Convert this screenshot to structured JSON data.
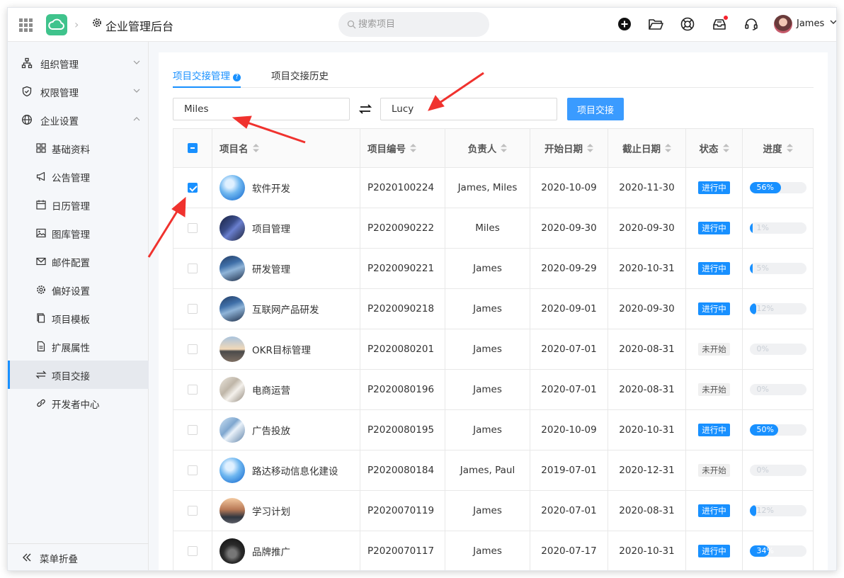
{
  "topbar": {
    "brand_title": "企业管理后台",
    "search_placeholder": "搜索项目",
    "user_name": "James"
  },
  "sidebar": {
    "items": [
      {
        "label": "组织管理",
        "icon": "org-chart-icon",
        "expandable": true
      },
      {
        "label": "权限管理",
        "icon": "shield-icon",
        "expandable": true
      },
      {
        "label": "企业设置",
        "icon": "globe-icon",
        "expandable": true,
        "expanded": true
      },
      {
        "label": "基础资料",
        "icon": "grid-icon"
      },
      {
        "label": "公告管理",
        "icon": "megaphone-icon"
      },
      {
        "label": "日历管理",
        "icon": "calendar-icon"
      },
      {
        "label": "图库管理",
        "icon": "image-icon"
      },
      {
        "label": "邮件配置",
        "icon": "mail-icon"
      },
      {
        "label": "偏好设置",
        "icon": "gear-icon"
      },
      {
        "label": "项目模板",
        "icon": "copy-icon"
      },
      {
        "label": "扩展属性",
        "icon": "document-icon"
      },
      {
        "label": "项目交接",
        "icon": "swap-icon",
        "active": true
      },
      {
        "label": "开发者中心",
        "icon": "link-icon"
      }
    ],
    "collapse_label": "菜单折叠"
  },
  "tabs": [
    {
      "label": "项目交接管理",
      "active": true
    },
    {
      "label": "项目交接历史"
    }
  ],
  "transfer": {
    "from_value": "Miles",
    "to_value": "Lucy",
    "button_label": "项目交接"
  },
  "table": {
    "headers": [
      "项目名",
      "项目编号",
      "负责人",
      "开始日期",
      "截止日期",
      "状态",
      "进度"
    ],
    "rows": [
      {
        "checked": true,
        "name": "软件开发",
        "code": "P2020100224",
        "owner": "James, Miles",
        "start": "2020-10-09",
        "end": "2020-11-30",
        "status": "进行中",
        "progress": 56,
        "progress_label": "56%",
        "thumb": "sky"
      },
      {
        "checked": false,
        "name": "项目管理",
        "code": "P2020090222",
        "owner": "Miles",
        "start": "2020-09-30",
        "end": "2020-09-30",
        "status": "进行中",
        "progress": 1,
        "progress_label": "1%",
        "thumb": "code"
      },
      {
        "checked": false,
        "name": "研发管理",
        "code": "P2020090221",
        "owner": "James",
        "start": "2020-09-29",
        "end": "2020-10-31",
        "status": "进行中",
        "progress": 5,
        "progress_label": "5%",
        "thumb": "code2"
      },
      {
        "checked": false,
        "name": "互联网产品研发",
        "code": "P2020090218",
        "owner": "James",
        "start": "2020-09-01",
        "end": "2020-09-30",
        "status": "进行中",
        "progress": 12,
        "progress_label": "12%",
        "thumb": "code2"
      },
      {
        "checked": false,
        "name": "OKR目标管理",
        "code": "P2020080201",
        "owner": "James",
        "start": "2020-07-01",
        "end": "2020-08-31",
        "status": "未开始",
        "progress": 0,
        "progress_label": "0%",
        "thumb": "dusk"
      },
      {
        "checked": false,
        "name": "电商运营",
        "code": "P2020080196",
        "owner": "James",
        "start": "2020-07-01",
        "end": "2020-08-31",
        "status": "未开始",
        "progress": 0,
        "progress_label": "0%",
        "thumb": "office"
      },
      {
        "checked": false,
        "name": "广告投放",
        "code": "P2020080195",
        "owner": "James",
        "start": "2020-10-09",
        "end": "2020-10-31",
        "status": "进行中",
        "progress": 50,
        "progress_label": "50%",
        "thumb": "building"
      },
      {
        "checked": false,
        "name": "路达移动信息化建设",
        "code": "P2020080184",
        "owner": "James, Paul",
        "start": "2019-07-01",
        "end": "2020-12-31",
        "status": "未开始",
        "progress": 0,
        "progress_label": "0%",
        "thumb": "sky"
      },
      {
        "checked": false,
        "name": "学习计划",
        "code": "P2020070119",
        "owner": "James",
        "start": "2020-07-01",
        "end": "2020-08-31",
        "status": "进行中",
        "progress": 12,
        "progress_label": "12%",
        "thumb": "mountain"
      },
      {
        "checked": false,
        "name": "品牌推广",
        "code": "P2020070117",
        "owner": "James",
        "start": "2020-07-17",
        "end": "2020-10-31",
        "status": "进行中",
        "progress": 34,
        "progress_label": "34%",
        "thumb": "car"
      }
    ]
  },
  "colors": {
    "accent": "#1890ff",
    "button": "#3a9bff",
    "annotation_arrow": "#f0322e",
    "logo": "#3fc38c"
  }
}
